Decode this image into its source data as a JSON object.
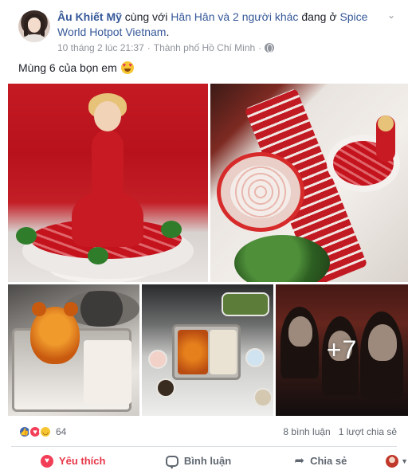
{
  "post": {
    "author": "Âu Khiết Mỹ",
    "with_text": "cùng với",
    "tagged_person": "Hân Hân",
    "and_others": "và 2 người khác",
    "at_text": "đang ở",
    "place": "Spice World Hotpot Vietnam",
    "place_suffix": ".",
    "timestamp": "10 tháng 2 lúc 21:37",
    "separator": "·",
    "location": "Thành phố Hồ Chí Minh",
    "location_separator": "·",
    "privacy_icon": "globe-icon",
    "more_icon": "chevron-down-icon",
    "caption": "Mùng 6 của bọn em",
    "caption_emoji": "heart-eyes-emoji"
  },
  "photos": {
    "more_count_label": "+7"
  },
  "engagement": {
    "reaction_icons": [
      "like-icon",
      "love-icon",
      "haha-icon"
    ],
    "reaction_count": "64",
    "comments": "8 bình luận",
    "shares": "1 lượt chia sẻ"
  },
  "actions": {
    "like_label": "Yêu thích",
    "comment_label": "Bình luận",
    "share_label": "Chia sẻ",
    "like_color": "#e73648",
    "text_color": "#606770"
  },
  "colors": {
    "link": "#365899",
    "meta": "#90949c",
    "divider": "#dadde1"
  }
}
